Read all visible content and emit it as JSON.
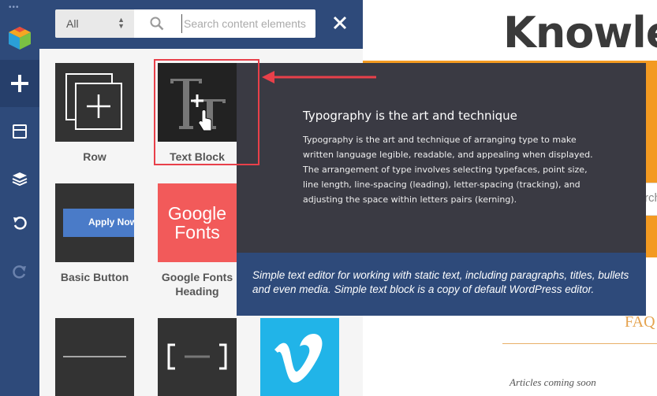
{
  "page": {
    "title": "Knowled",
    "search_peek": "rch",
    "faq_peek": "FAQ",
    "articles_note": "Articles coming soon"
  },
  "rail": {
    "dots": "•••"
  },
  "panel": {
    "filter": {
      "value": "All"
    },
    "search": {
      "placeholder": "Search content elements"
    }
  },
  "elements": [
    {
      "label": "Row",
      "icon": "row-icon"
    },
    {
      "label": "Text Block",
      "icon": "text-block-icon"
    },
    {
      "label": "Basic Button",
      "icon": "basic-button-icon",
      "button_text": "Apply Now"
    },
    {
      "label": "Google Fonts Heading",
      "icon": "google-fonts-icon",
      "logo_line1": "Google",
      "logo_line2": "Fonts"
    },
    {
      "label": "",
      "icon": "separator-icon"
    },
    {
      "label": "",
      "icon": "bracket-icon"
    },
    {
      "label": "",
      "icon": "vimeo-icon"
    }
  ],
  "tooltip": {
    "title": "Typography is the art and technique",
    "body": "Typography is the art and technique of arranging type to make written language legible, readable, and appealing when displayed. The arrangement of type involves selecting typefaces, point size, line length, line-spacing (leading), letter-spacing (tracking), and adjusting the space within letters pairs (kerning).",
    "description": "Simple text editor for working with static text, including paragraphs, titles, bullets and even media. Simple text block is a copy of default WordPress editor."
  },
  "colors": {
    "rail": "#2e4a7a",
    "accent_orange": "#f39a21",
    "highlight_red": "#e8404a",
    "google_fonts_tile": "#f25a5a",
    "vimeo_tile": "#21b4e8"
  }
}
